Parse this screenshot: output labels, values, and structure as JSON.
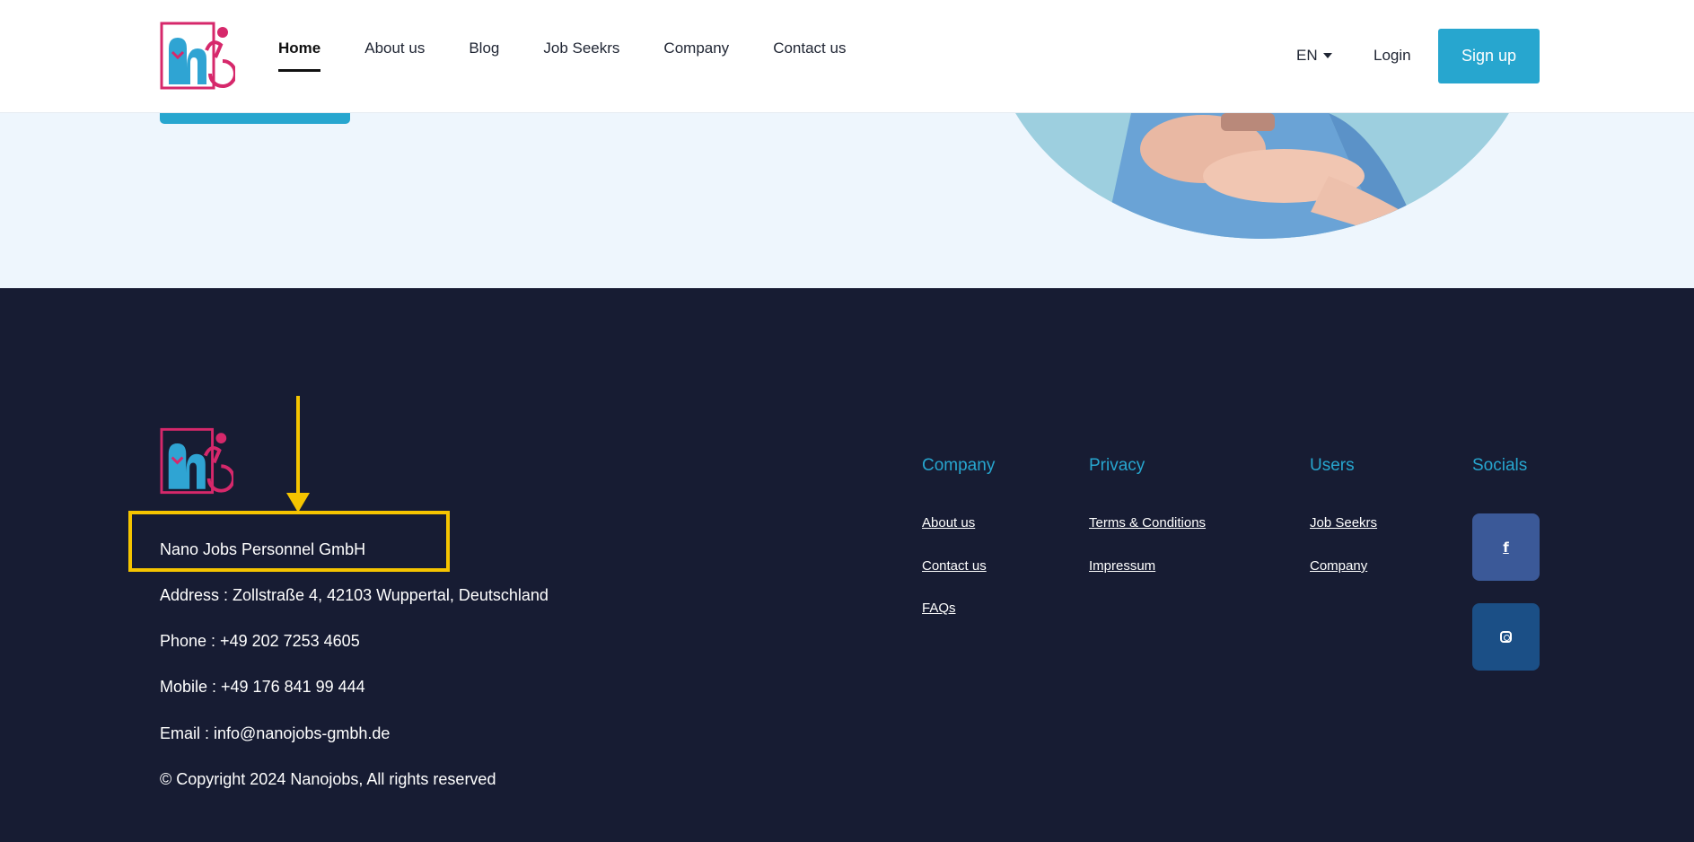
{
  "header": {
    "nav": [
      {
        "label": "Home",
        "active": true
      },
      {
        "label": "About us"
      },
      {
        "label": "Blog"
      },
      {
        "label": "Job Seekrs"
      },
      {
        "label": "Company"
      },
      {
        "label": "Contact us"
      }
    ],
    "lang": "EN",
    "login": "Login",
    "signup": "Sign up"
  },
  "footer": {
    "company_name": "Nano Jobs Personnel GmbH",
    "address": "Address : Zollstraße 4, 42103 Wuppertal, Deutschland",
    "phone": "Phone : +49 202 7253 4605",
    "mobile": "Mobile : +49 176 841 99 444",
    "email": "Email : info@nanojobs-gmbh.de",
    "copyright": "© Copyright 2024 Nanojobs, All rights reserved",
    "columns": {
      "company": {
        "title": "Company",
        "links": [
          "About us",
          "Contact us",
          "FAQs"
        ]
      },
      "privacy": {
        "title": "Privacy",
        "links": [
          "Terms & Conditions",
          "Impressum"
        ]
      },
      "users": {
        "title": "Users",
        "links": [
          "Job Seekrs",
          "Company"
        ]
      },
      "socials": {
        "title": "Socials",
        "items": [
          "facebook-icon",
          "instagram-icon"
        ]
      }
    }
  },
  "colors": {
    "accent": "#27a6cf",
    "footer_bg": "#171c33",
    "highlight": "#f5c400",
    "facebook": "#3b5998",
    "instagram": "#1b4f86"
  }
}
